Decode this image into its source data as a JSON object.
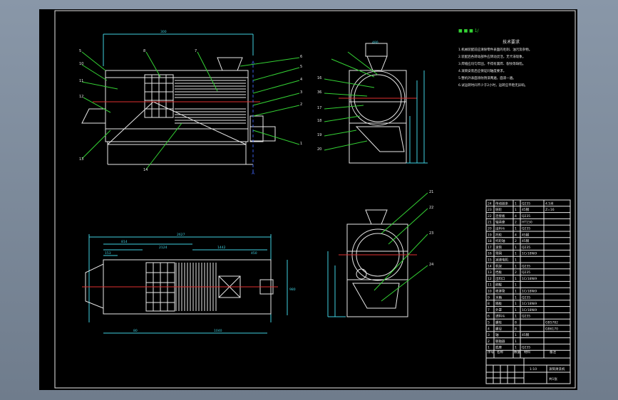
{
  "drawing": {
    "title_mark": "■ ■ ■ 1/",
    "notes_heading": "技术要求",
    "notes": [
      "1.机械装配前应清除零件表面的毛刺、油污及杂物。",
      "2.装配后各转动部件应转动灵活，无卡滞现象。",
      "3.焊缝应均匀牢固，不得有漏焊、裂纹等缺陷。",
      "4.滚筒安装后应保证同轴度要求。",
      "5.整机外表面涂防锈漆两遍，面漆一遍。",
      "6.试运转时间不少于2小时，运转应平稳无异响。"
    ],
    "dims": {
      "top_left": "300",
      "hopper": "480",
      "plan_total": "2627",
      "plan_a": "814",
      "plan_b": "2124",
      "plan_c": "1442",
      "plan_d": "450",
      "plan_e": "153",
      "plan_bottom_left": "80",
      "plan_bottom_right": "1040",
      "plan_height": "980"
    },
    "side_callouts": [
      "5",
      "10",
      "11",
      "12",
      "8",
      "7",
      "6",
      "5",
      "4",
      "3",
      "2",
      "1",
      "13",
      "14"
    ],
    "end_callouts_left": [
      "16",
      "36",
      "17",
      "18",
      "19",
      "20"
    ],
    "section_callouts_right": [
      "21",
      "22",
      "23",
      "24"
    ],
    "bom": [
      {
        "no": "24",
        "name": "传动链条",
        "qty": "1",
        "material": "Q235",
        "note": "4.5米"
      },
      {
        "no": "23",
        "name": "链轮",
        "qty": "1",
        "material": "45钢",
        "note": "Z=16"
      },
      {
        "no": "22",
        "name": "连接板",
        "qty": "4",
        "material": "Q235",
        "note": ""
      },
      {
        "no": "21",
        "name": "轴承座",
        "qty": "2",
        "material": "HT150",
        "note": ""
      },
      {
        "no": "20",
        "name": "出料斗",
        "qty": "1",
        "material": "Q235",
        "note": ""
      },
      {
        "no": "19",
        "name": "托轮",
        "qty": "4",
        "material": "45钢",
        "note": ""
      },
      {
        "no": "18",
        "name": "托轮轴",
        "qty": "2",
        "material": "45钢",
        "note": ""
      },
      {
        "no": "17",
        "name": "滚筒",
        "qty": "1",
        "material": "Q235",
        "note": ""
      },
      {
        "no": "16",
        "name": "筛网",
        "qty": "1",
        "material": "1Cr18Ni9",
        "note": ""
      },
      {
        "no": "15",
        "name": "减速电机",
        "qty": "1",
        "material": "",
        "note": ""
      },
      {
        "no": "14",
        "name": "机架",
        "qty": "1",
        "material": "Q235",
        "note": ""
      },
      {
        "no": "13",
        "name": "挡板",
        "qty": "2",
        "material": "Q235",
        "note": ""
      },
      {
        "no": "12",
        "name": "出料口",
        "qty": "1",
        "material": "1Cr18Ni9",
        "note": ""
      },
      {
        "no": "11",
        "name": "刷辊",
        "qty": "1",
        "material": "",
        "note": ""
      },
      {
        "no": "10",
        "name": "喷淋管",
        "qty": "1",
        "material": "1Cr18Ni9",
        "note": ""
      },
      {
        "no": "9",
        "name": "水箱",
        "qty": "1",
        "material": "Q235",
        "note": ""
      },
      {
        "no": "8",
        "name": "隔板",
        "qty": "1",
        "material": "1Cr18Ni9",
        "note": ""
      },
      {
        "no": "7",
        "name": "外罩",
        "qty": "1",
        "material": "1Cr18Ni9",
        "note": ""
      },
      {
        "no": "6",
        "name": "进料斗",
        "qty": "1",
        "material": "Q235",
        "note": ""
      },
      {
        "no": "5",
        "name": "螺栓",
        "qty": "8",
        "material": "",
        "note": "GB5782"
      },
      {
        "no": "4",
        "name": "螺母",
        "qty": "8",
        "material": "",
        "note": "GB6170"
      },
      {
        "no": "3",
        "name": "轴",
        "qty": "1",
        "material": "45钢",
        "note": ""
      },
      {
        "no": "2",
        "name": "联轴器",
        "qty": "1",
        "material": "",
        "note": ""
      },
      {
        "no": "1",
        "name": "底座",
        "qty": "1",
        "material": "Q235",
        "note": ""
      }
    ],
    "bom_header": {
      "no": "序号",
      "name": "名称",
      "qty": "数量",
      "material": "材料",
      "note": "备注"
    },
    "title_block": {
      "drawing_name": "滚筒清洗机",
      "scale": "1:10",
      "sheet": "共1张"
    }
  }
}
